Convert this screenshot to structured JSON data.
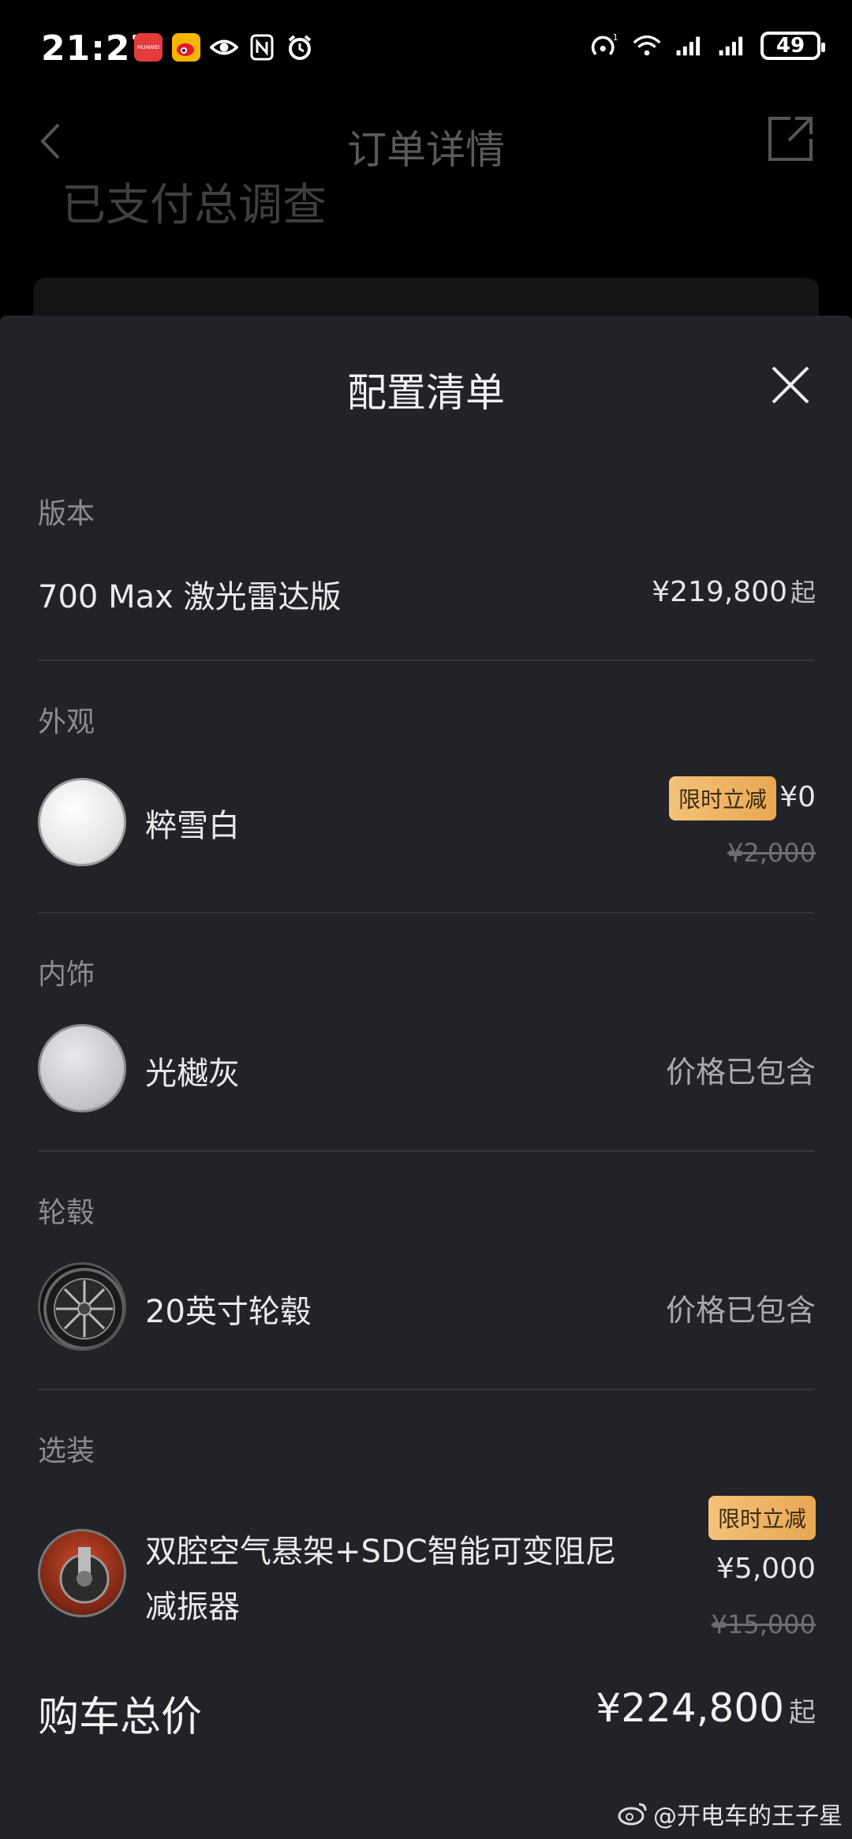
{
  "status_bar": {
    "time": "21:27",
    "battery": "49",
    "huawei_label": "HUAWEI"
  },
  "background_page": {
    "title": "订单详情",
    "subtitle": "已支付总调查"
  },
  "sheet": {
    "title": "配置清单",
    "sections": {
      "version": {
        "label": "版本",
        "name": "700 Max 激光雷达版",
        "price": "¥219,800",
        "price_suffix": "起"
      },
      "exterior": {
        "label": "外观",
        "name": "粹雪白",
        "badge": "限时立减",
        "price": "¥0",
        "original_price": "¥2,000"
      },
      "interior": {
        "label": "内饰",
        "name": "光樾灰",
        "price_note": "价格已包含"
      },
      "wheels": {
        "label": "轮毂",
        "name": "20英寸轮毂",
        "price_note": "价格已包含"
      },
      "options": {
        "label": "选装",
        "name_line1": "双腔空气悬架+SDC智能可变阻尼",
        "name_line2": "减振器",
        "badge": "限时立减",
        "price": "¥5,000",
        "original_price": "¥15,000"
      }
    },
    "total": {
      "label": "购车总价",
      "price": "¥224,800",
      "price_suffix": "起"
    }
  },
  "watermark": "@开电车的王子星",
  "colors": {
    "sheet_bg": "#212328",
    "badge_gold": "#f0b866",
    "text_muted": "#8a8c91"
  }
}
